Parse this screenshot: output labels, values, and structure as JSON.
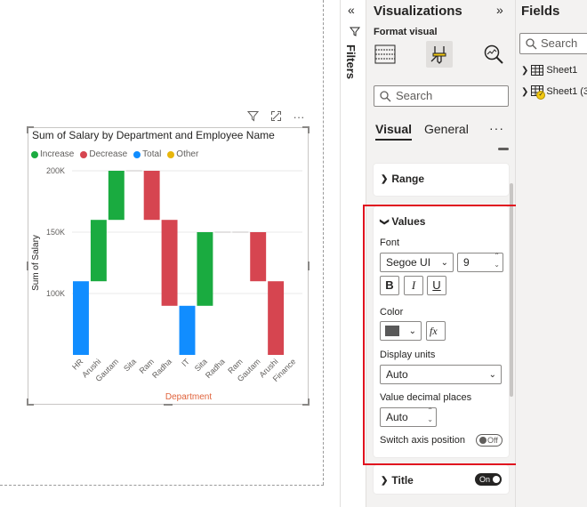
{
  "canvas": {
    "visual_header_icons": [
      "filter-icon",
      "focus-mode-icon",
      "more-options-icon"
    ],
    "chart_data": {
      "type": "waterfall",
      "title": "Sum of Salary by Department and Employee Name",
      "xlabel": "Department",
      "ylabel": "Sum of Salary",
      "ylim": [
        50000,
        200000
      ],
      "yticks": [
        "100K",
        "150K",
        "200K"
      ],
      "ytick_values": [
        100000,
        150000,
        200000
      ],
      "legend": [
        {
          "name": "Increase",
          "color": "#1aab40"
        },
        {
          "name": "Decrease",
          "color": "#d64550"
        },
        {
          "name": "Total",
          "color": "#118dff"
        },
        {
          "name": "Other",
          "color": "#e8b60c"
        }
      ],
      "categories": [
        "HR",
        "Arushi",
        "Gautam",
        "Sita",
        "Ram",
        "Radha",
        "IT",
        "Sita",
        "Radha",
        "Ram",
        "Gautam",
        "Arushi",
        "Finance"
      ],
      "bars": [
        {
          "kind": "Total",
          "start": 0,
          "end": 110000
        },
        {
          "kind": "Increase",
          "start": 110000,
          "end": 160000
        },
        {
          "kind": "Increase",
          "start": 160000,
          "end": 200000
        },
        {
          "kind": "Other",
          "start": 200000,
          "end": 200000
        },
        {
          "kind": "Decrease",
          "start": 200000,
          "end": 160000
        },
        {
          "kind": "Decrease",
          "start": 160000,
          "end": 90000
        },
        {
          "kind": "Total",
          "start": 0,
          "end": 90000
        },
        {
          "kind": "Increase",
          "start": 90000,
          "end": 150000
        },
        {
          "kind": "Other",
          "start": 150000,
          "end": 150000
        },
        {
          "kind": "Decrease",
          "start": 150000,
          "end": 150000
        },
        {
          "kind": "Decrease",
          "start": 150000,
          "end": 110000
        },
        {
          "kind": "Decrease",
          "start": 110000,
          "end": 50000
        },
        {
          "kind": "Total",
          "start": 0,
          "end": 0
        }
      ]
    }
  },
  "filters": {
    "label": "Filters"
  },
  "visualizations": {
    "title": "Visualizations",
    "subtitle": "Format visual",
    "search_placeholder": "Search",
    "tabs": [
      "Visual",
      "General"
    ],
    "range_label": "Range",
    "values": {
      "header": "Values",
      "font_label": "Font",
      "font_family": "Segoe UI",
      "font_size": "9",
      "bold": "B",
      "italic": "I",
      "underline": "U",
      "color_label": "Color",
      "color_value": "#595959",
      "fx_label": "fx",
      "display_units_label": "Display units",
      "display_units_value": "Auto",
      "decimal_label": "Value decimal places",
      "decimal_value": "Auto",
      "axis_position_label": "Switch axis position",
      "axis_position_toggle": "Off"
    },
    "title_section": {
      "label": "Title",
      "toggle": "On"
    }
  },
  "fields": {
    "title": "Fields",
    "search_placeholder": "Search",
    "tables": [
      "Sheet1",
      "Sheet1 (3"
    ]
  }
}
